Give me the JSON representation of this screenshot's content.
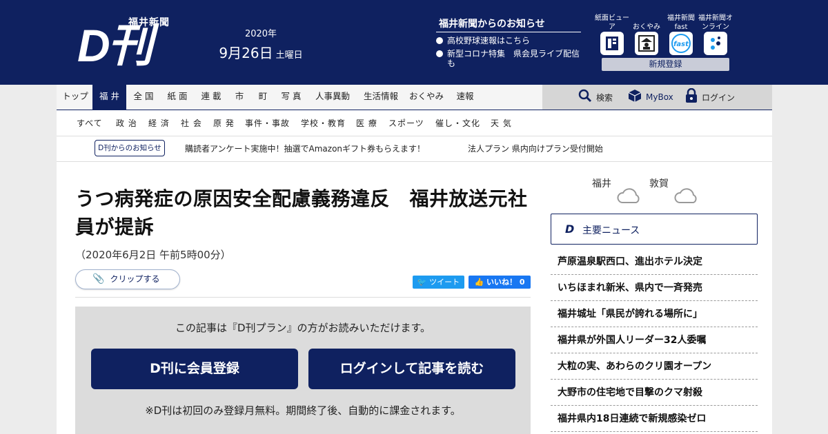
{
  "header": {
    "logo_top": "福井新聞",
    "logo_main": "D刊",
    "date_year": "2020年",
    "date_main": "9月26日",
    "date_dow": "土曜日",
    "notice_title": "福井新聞からのお知らせ",
    "notices": [
      "高校野球速報はこちら",
      "新型コロナ特集　県会見ライブ配信も"
    ],
    "apps": [
      {
        "label": "紙面ビューア",
        "icon": "newspaper-viewer-icon"
      },
      {
        "label": "おくやみ",
        "icon": "obituary-icon"
      },
      {
        "label": "福井新聞fast",
        "icon": "fast-app-icon"
      },
      {
        "label": "福井新聞オンライン",
        "icon": "online-app-icon"
      }
    ],
    "register": "新規登録"
  },
  "nav": {
    "items": [
      "トップ",
      "福 井",
      "全 国",
      "紙 面",
      "連 載",
      "市",
      "町",
      "写 真",
      "人事異動",
      "生活情報",
      "おくやみ",
      "速報"
    ],
    "active": "福 井",
    "search": "検索",
    "mybox": "MyBox",
    "login": "ログイン"
  },
  "subnav": {
    "items": [
      "すべて",
      "政 治",
      "経 済",
      "社 会",
      "原 発",
      "事件・事故",
      "学校・教育",
      "医 療",
      "スポーツ",
      "催し・文化",
      "天 気"
    ]
  },
  "infobar": {
    "badge": "D刊からのお知らせ",
    "links": [
      "購読者アンケート実施中！抽選でAmazonギフト券もらえます！",
      "法人プラン 県内向けプラン受付開始"
    ]
  },
  "article": {
    "title": "うつ病発症の原因安全配慮義務違反　福井放送元社員が提訴",
    "date": "（2020年6月2日 午前5時00分）",
    "clip": "クリップする",
    "tweet": "ツイート",
    "like": "いいね！ 0"
  },
  "paywall": {
    "text": "この記事は『D刊プラン』の方がお読みいただけます。",
    "register_btn": "D刊に会員登録",
    "login_btn": "ログインして記事を読む",
    "note": "※D刊は初回のみ登録月無料。期間終了後、自動的に課金されます。"
  },
  "sidebar": {
    "weather": [
      {
        "city": "福井",
        "icon": "cloud-icon"
      },
      {
        "city": "敦賀",
        "icon": "cloud-icon"
      }
    ],
    "news_icon": "D",
    "news_title": "主要ニュース",
    "news": [
      "芦原温泉駅西口、進出ホテル決定",
      "いちほまれ新米、県内で一斉発売",
      "福井城址「県民が誇れる場所に」",
      "福井県が外国人リーダー32人委嘱",
      "大粒の実、あわらのクリ園オープン",
      "大野市の住宅地で目撃のクマ射殺",
      "福井県内18日連続で新規感染ゼロ"
    ]
  },
  "colors": {
    "brand_navy": "#0f2160",
    "paywall_bg": "#dcdcdc",
    "tweet": "#1d9bf0",
    "like": "#1877f2"
  }
}
